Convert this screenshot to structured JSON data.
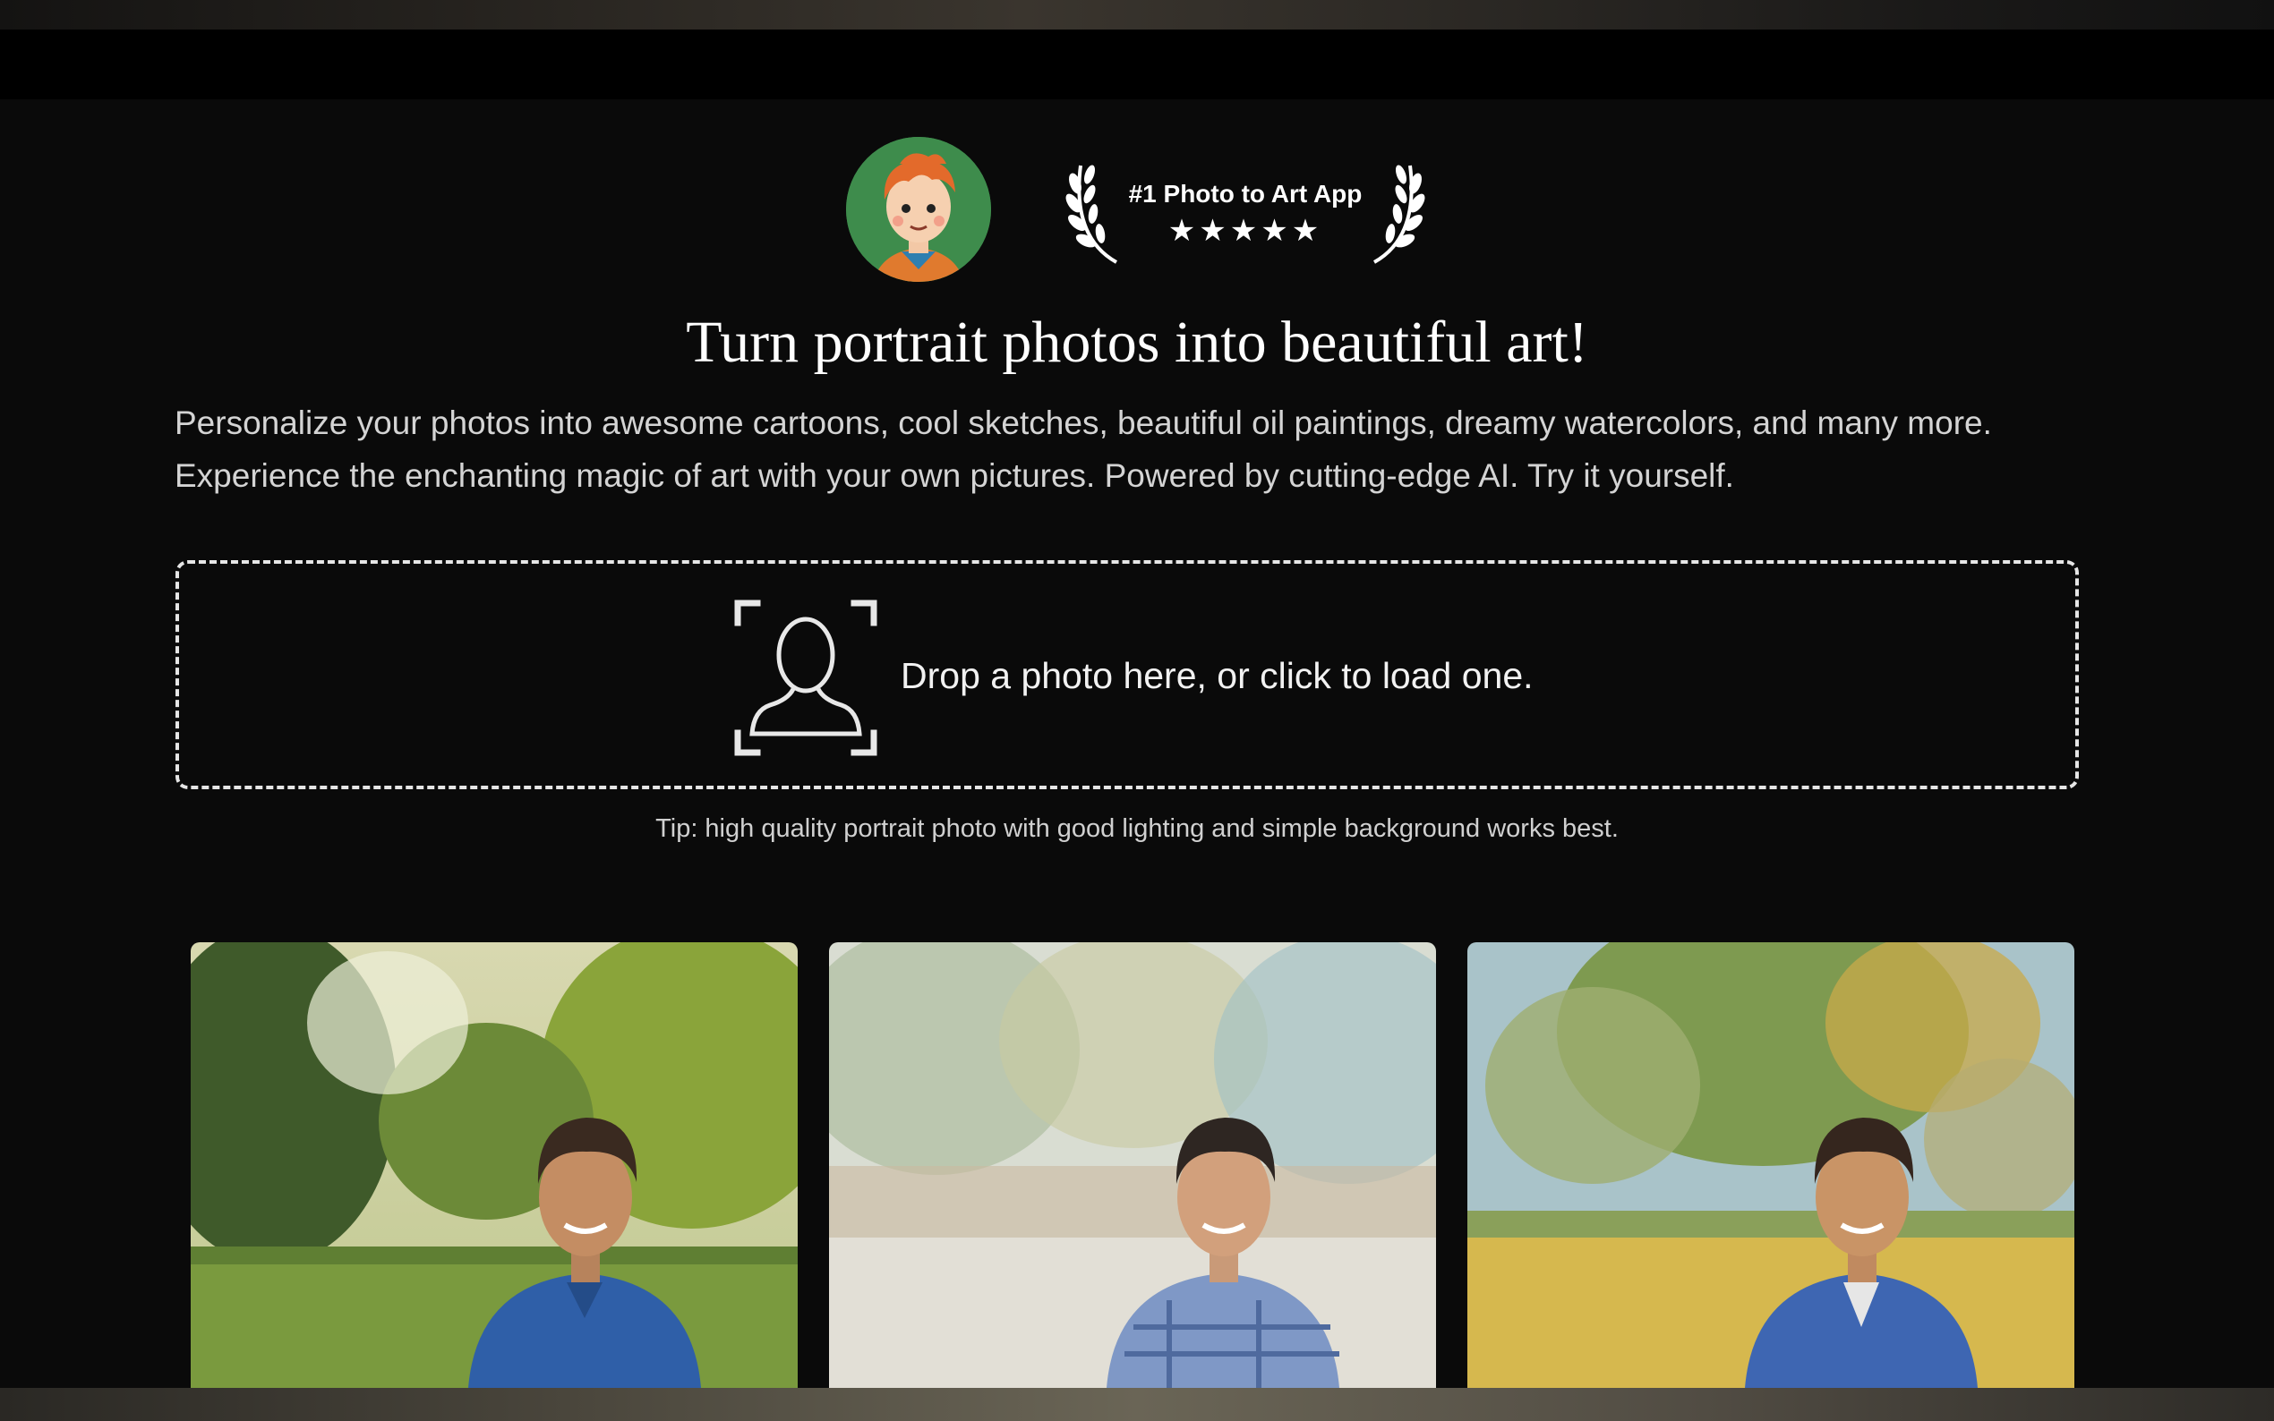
{
  "badge": {
    "title": "#1 Photo to Art App",
    "stars": "★★★★★",
    "rating": 5
  },
  "headline": "Turn portrait photos into beautiful art!",
  "description": {
    "line1": "Personalize your photos into awesome cartoons, cool sketches, beautiful oil paintings, dreamy watercolors, and many more.",
    "line2": "Experience the enchanting magic of art with your own pictures. Powered by cutting-edge AI. Try it yourself."
  },
  "dropzone": {
    "label": "Drop a photo here, or click to load one.",
    "icon": "portrait-upload-icon"
  },
  "tip": "Tip: high quality portrait photo with good lighting and simple background works best.",
  "gallery": [
    {
      "style": "photo"
    },
    {
      "style": "watercolor"
    },
    {
      "style": "oil-painting"
    }
  ],
  "colors": {
    "background": "#0a0a0a",
    "text": "#ffffff",
    "muted_text": "#d4d4d4",
    "dashed_border": "#e6e6e6"
  }
}
